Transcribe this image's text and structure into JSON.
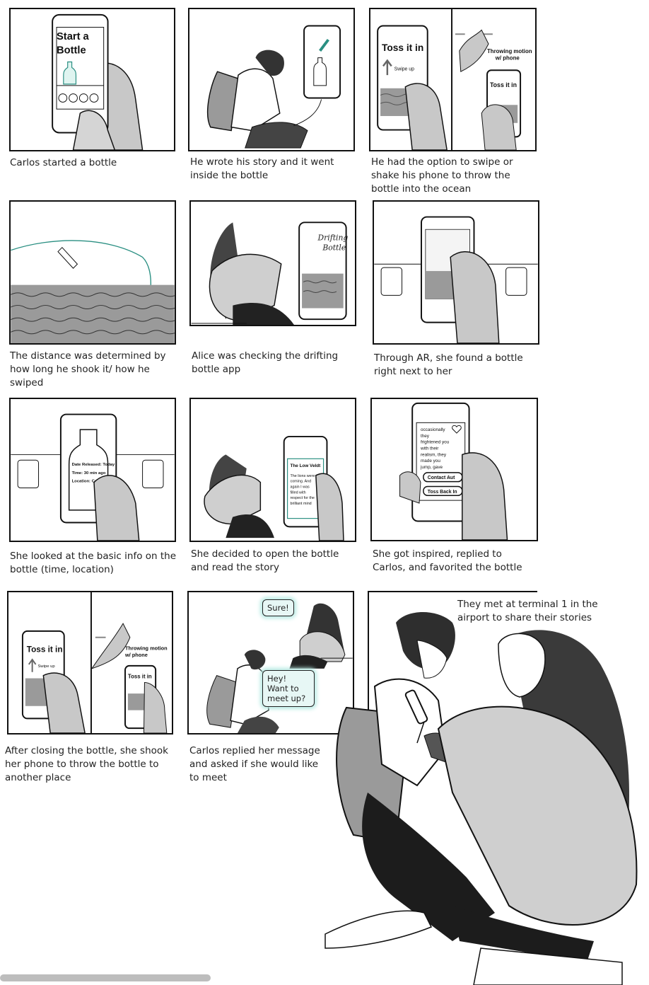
{
  "panels": [
    {
      "caption": "Carlos started a bottle",
      "screen": [
        "Start a",
        "Bottle"
      ]
    },
    {
      "caption": "He wrote his story and it went inside the bottle"
    },
    {
      "caption": "He had the option to swipe or shake his phone to throw the bottle into the ocean",
      "screen": "Toss it in",
      "hint": "Swipe up",
      "motion": [
        "Throwing motion",
        "w/ phone"
      ]
    },
    {
      "caption": "The distance was determined by how long he shook it/ how he swiped"
    },
    {
      "caption": "Alice was checking the drifting bottle app",
      "screen": [
        "Drifting",
        "Bottle"
      ]
    },
    {
      "caption": "Through AR, she found a  bottle right next to her"
    },
    {
      "caption": "She looked at the basic info on the bottle (time, location)",
      "info": [
        "Date Released: Today",
        "Time: 30 min ago",
        "Location: Ca"
      ]
    },
    {
      "caption": "She decided to open the bottle and read the story",
      "story_title": "The Low Veldt",
      "story": [
        "The lions were",
        "coming. And",
        "again I was",
        "filled with",
        "respect for the",
        "brilliant mind"
      ]
    },
    {
      "caption": "She got inspired, replied to Carlos, and favorited the bottle",
      "story": [
        "occasionally",
        "they",
        "frightened you",
        "with their",
        "realism, they",
        "made you",
        "jump, gave"
      ],
      "buttons": [
        "Contact Aut",
        "Toss Back In"
      ]
    },
    {
      "caption": "After closing the bottle, she shook her phone to throw the bottle to another place",
      "screen": "Toss it in",
      "hint": "Swipe up",
      "motion": [
        "Throwing motion",
        "w/ phone"
      ]
    },
    {
      "caption": "Carlos replied her message and asked if she would like to meet",
      "bubble_alice": "Sure!",
      "bubble_carlos": "Hey! Want to meet up?"
    },
    {
      "caption": "They met at terminal 1 in the airport to share their stories"
    }
  ]
}
